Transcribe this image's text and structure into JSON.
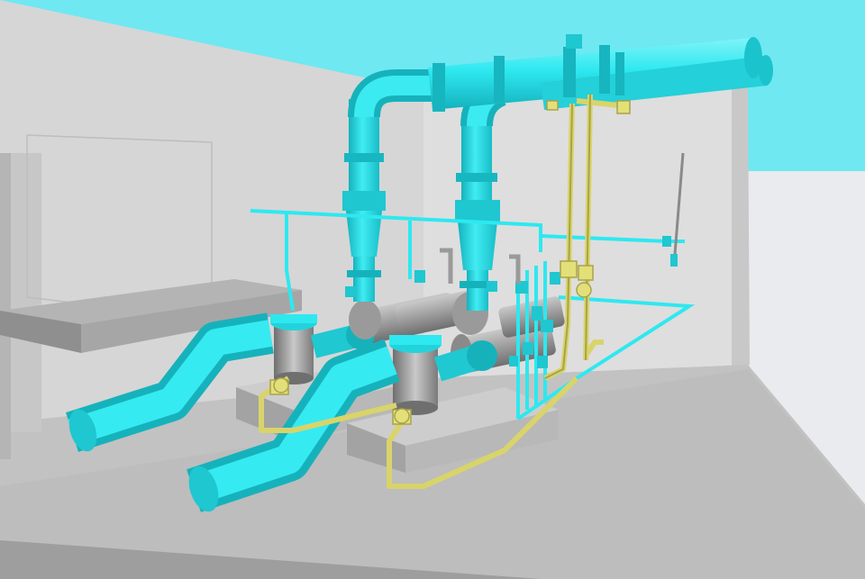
{
  "scene": {
    "description_visible_text": "",
    "colors": {
      "sky": "#6fe8f2",
      "ground": "#e8eaed",
      "wall_light": "#d9d9d9",
      "wall_mid": "#c4c4c4",
      "floor": "#bcbcbc",
      "pipe_cyan": "#2ee8f0",
      "pipe_cyan_dark": "#16b9c3",
      "pipe_yellow": "#e3e07a",
      "pipe_yellow_dark": "#a8a34a",
      "steel": "#a8a8a8",
      "steel_dark": "#7d7d7d",
      "plinth": "#cfcfcf"
    }
  }
}
